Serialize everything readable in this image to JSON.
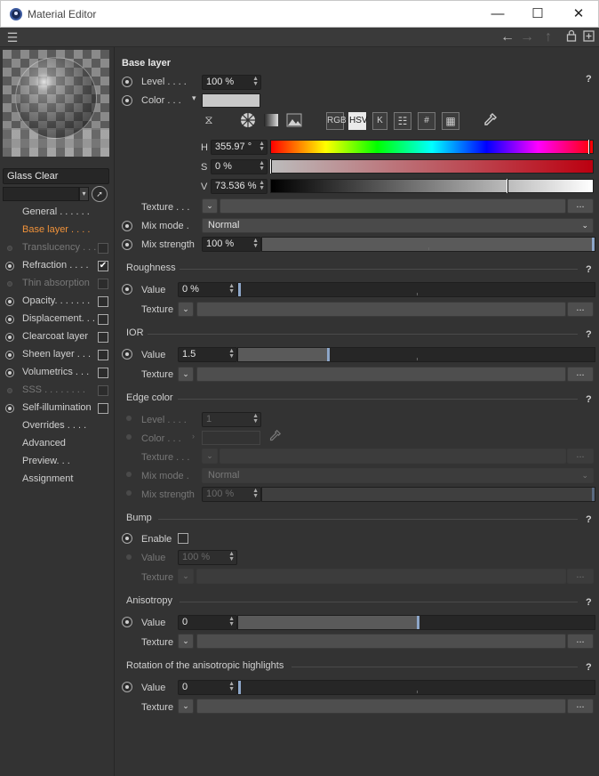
{
  "window": {
    "title": "Material Editor",
    "minimize": "—",
    "maximize": "☐",
    "close": "✕"
  },
  "toolbar": {
    "menu": "☰",
    "back": "←",
    "forward": "→",
    "up": "↑",
    "lock": "🔒",
    "new": "⊞"
  },
  "sidebar": {
    "material_name": "Glass Clear",
    "channels": [
      {
        "label": "General . . . . . .",
        "radio": false,
        "checkbox": null,
        "state": "normal"
      },
      {
        "label": "Base layer . . . .",
        "radio": false,
        "checkbox": null,
        "state": "active"
      },
      {
        "label": "Translucency . . .",
        "radio": "dim",
        "checkbox": "off-dim",
        "state": "dim"
      },
      {
        "label": "Refraction . . . .",
        "radio": "on",
        "checkbox": "on",
        "state": "normal"
      },
      {
        "label": "Thin absorption",
        "radio": "dim",
        "checkbox": "off-dim",
        "state": "dim"
      },
      {
        "label": "Opacity. . . . . . .",
        "radio": "on",
        "checkbox": "off",
        "state": "normal"
      },
      {
        "label": "Displacement. . .",
        "radio": "on",
        "checkbox": "off",
        "state": "normal"
      },
      {
        "label": "Clearcoat layer",
        "radio": "on",
        "checkbox": "off",
        "state": "normal"
      },
      {
        "label": "Sheen layer . . .",
        "radio": "on",
        "checkbox": "off",
        "state": "normal"
      },
      {
        "label": "Volumetrics . . .",
        "radio": "on",
        "checkbox": "off",
        "state": "normal"
      },
      {
        "label": "SSS . . . . . . . .",
        "radio": "dim",
        "checkbox": "off-dim",
        "state": "dim"
      },
      {
        "label": "Self-illumination",
        "radio": "on",
        "checkbox": "off",
        "state": "normal"
      },
      {
        "label": "Overrides . . . .",
        "radio": false,
        "checkbox": null,
        "state": "normal"
      },
      {
        "label": "Advanced",
        "radio": false,
        "checkbox": null,
        "state": "normal"
      },
      {
        "label": "Preview. . .",
        "radio": false,
        "checkbox": null,
        "state": "normal"
      },
      {
        "label": "Assignment",
        "radio": false,
        "checkbox": null,
        "state": "normal"
      }
    ]
  },
  "base_layer": {
    "title": "Base layer",
    "help": "?",
    "level_label": "Level . . . .",
    "level_value": "100 %",
    "color_label": "Color . . .",
    "color_swatch": "#c8c8c8",
    "color_modes": [
      "RGB",
      "HSV",
      "K",
      "#"
    ],
    "h_label": "H",
    "h_value": "355.97 °",
    "h_fraction": 0.989,
    "s_label": "S",
    "s_value": "0 %",
    "s_fraction": 0.0,
    "v_label": "V",
    "v_value": "73.536 %",
    "v_fraction": 0.735,
    "texture_label": "Texture . . .",
    "dots": "...",
    "mix_mode_label": "Mix mode .",
    "mix_mode_value": "Normal",
    "mix_strength_label": "Mix strength",
    "mix_strength_value": "100 %",
    "mix_strength_fraction": 1.0
  },
  "roughness": {
    "title": "Roughness",
    "value_label": "Value",
    "value": "0 %",
    "fraction": 0.0,
    "texture_label": "Texture"
  },
  "ior": {
    "title": "IOR",
    "value_label": "Value",
    "value": "1.5",
    "fraction": 0.25,
    "texture_label": "Texture"
  },
  "edge_color": {
    "title": "Edge color",
    "level_label": "Level . . . .",
    "level_value": "1",
    "color_label": "Color . . .",
    "texture_label": "Texture . . .",
    "mix_mode_label": "Mix mode .",
    "mix_mode_value": "Normal",
    "mix_strength_label": "Mix strength",
    "mix_strength_value": "100 %"
  },
  "bump": {
    "title": "Bump",
    "enable_label": "Enable",
    "value_label": "Value",
    "value": "100 %",
    "texture_label": "Texture"
  },
  "anisotropy": {
    "title": "Anisotropy",
    "value_label": "Value",
    "value": "0",
    "fraction": 0.5,
    "texture_label": "Texture"
  },
  "rotation": {
    "title": "Rotation of the anisotropic highlights",
    "value_label": "Value",
    "value": "0",
    "fraction": 0.0,
    "texture_label": "Texture"
  }
}
